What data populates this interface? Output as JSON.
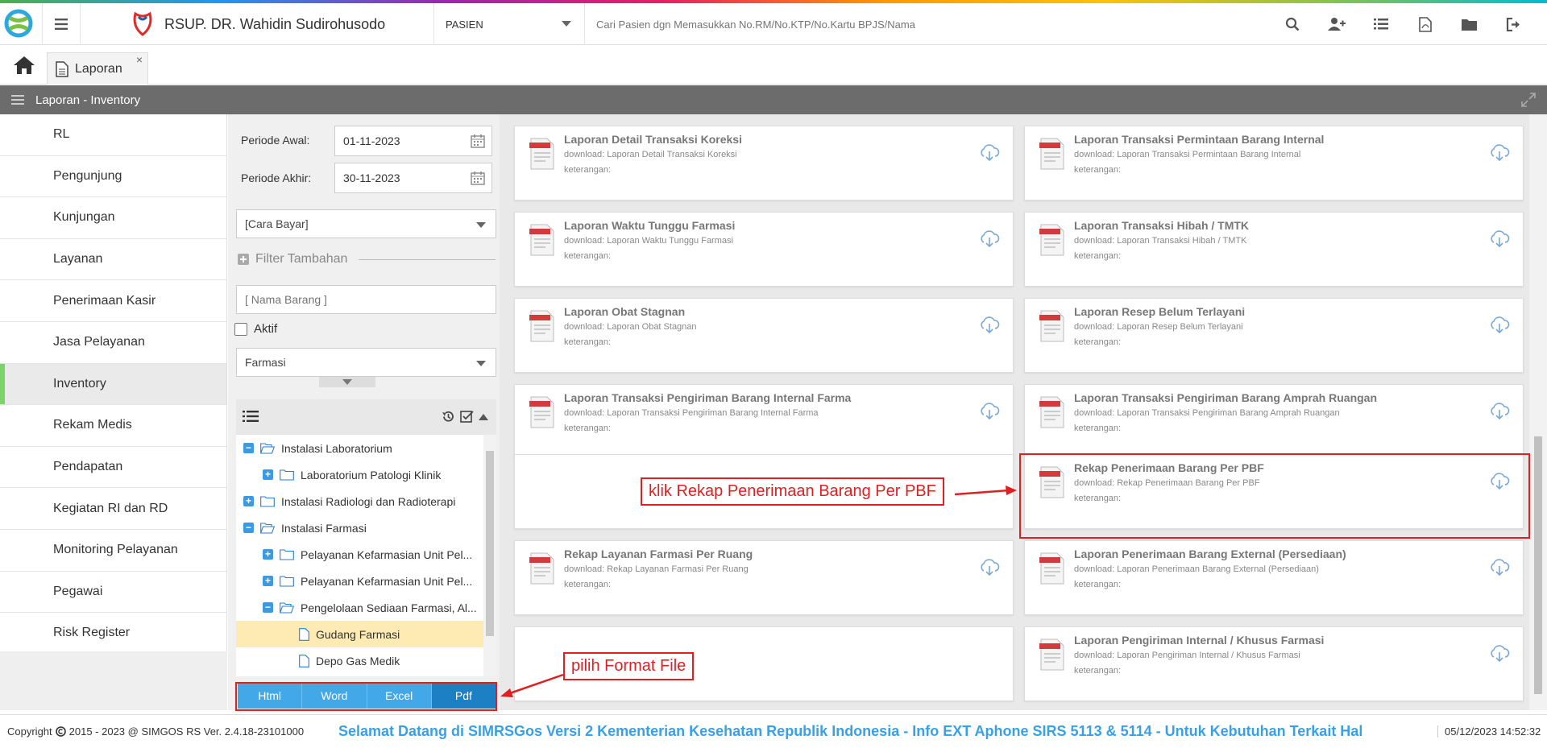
{
  "header": {
    "hospital_name": "RSUP. DR. Wahidin Sudirohusodo",
    "patient_type": "PASIEN",
    "search_placeholder": "Cari Pasien dgn Memasukkan No.RM/No.KTP/No.Kartu BPJS/Nama",
    "icons": [
      "search-icon",
      "add-user-icon",
      "list-icon",
      "pdf-file-icon",
      "folder-icon",
      "logout-icon"
    ]
  },
  "tabs": {
    "active_label": "Laporan",
    "close_glyph": "×"
  },
  "titlebar": {
    "title": "Laporan - Inventory"
  },
  "sidebar": {
    "items": [
      "RL",
      "Pengunjung",
      "Kunjungan",
      "Layanan",
      "Penerimaan Kasir",
      "Jasa Pelayanan",
      "Inventory",
      "Rekam Medis",
      "Pendapatan",
      "Kegiatan RI dan RD",
      "Monitoring Pelayanan",
      "Pegawai",
      "Risk Register"
    ],
    "active": "Inventory"
  },
  "filter": {
    "periode_awal_label": "Periode Awal:",
    "periode_awal_value": "01-11-2023",
    "periode_akhir_label": "Periode Akhir:",
    "periode_akhir_value": "30-11-2023",
    "cara_bayar": "[Cara Bayar]",
    "filter_tambahan": "Filter Tambahan",
    "nama_barang_placeholder": "[ Nama Barang ]",
    "aktif_label": "Aktif",
    "unit": "Farmasi"
  },
  "tree": {
    "items": [
      {
        "label": "Instalasi Laboratorium",
        "toggle": "−",
        "icon": "folder-open"
      },
      {
        "label": "Laboratorium Patologi Klinik",
        "toggle": "+",
        "icon": "folder"
      },
      {
        "label": "Instalasi Radiologi dan Radioterapi",
        "toggle": "+",
        "icon": "folder"
      },
      {
        "label": "Instalasi Farmasi",
        "toggle": "−",
        "icon": "folder-open"
      },
      {
        "label": "Pelayanan Kefarmasian Unit Pel...",
        "toggle": "+",
        "icon": "folder"
      },
      {
        "label": "Pelayanan Kefarmasian Unit Pel...",
        "toggle": "+",
        "icon": "folder"
      },
      {
        "label": "Pengelolaan Sediaan Farmasi, Al...",
        "toggle": "−",
        "icon": "folder-open"
      },
      {
        "label": "Gudang Farmasi",
        "toggle": "",
        "icon": "file"
      },
      {
        "label": "Depo Gas Medik",
        "toggle": "",
        "icon": "file"
      }
    ],
    "selected": "Gudang Farmasi"
  },
  "formats": [
    "Html",
    "Word",
    "Excel",
    "Pdf"
  ],
  "format_selected": "Pdf",
  "reports": {
    "download_prefix": "download: ",
    "keterangan_label": "keterangan:",
    "items": [
      {
        "title": "Laporan Detail Transaksi Koreksi",
        "download": "Laporan Detail Transaksi Koreksi"
      },
      {
        "title": "Laporan Transaksi Permintaan Barang Internal",
        "download": "Laporan Transaksi Permintaan Barang Internal"
      },
      {
        "title": "Laporan Waktu Tunggu Farmasi",
        "download": "Laporan Waktu Tunggu Farmasi"
      },
      {
        "title": "Laporan Transaksi Hibah / TMTK",
        "download": "Laporan Transaksi Hibah / TMTK"
      },
      {
        "title": "Laporan Obat Stagnan",
        "download": "Laporan Obat Stagnan"
      },
      {
        "title": "Laporan Resep Belum Terlayani",
        "download": "Laporan Resep Belum Terlayani"
      },
      {
        "title": "Laporan Transaksi Pengiriman Barang Internal Farma",
        "download": "Laporan Transaksi Pengiriman Barang Internal Farma"
      },
      {
        "title": "Laporan Transaksi Pengiriman Barang Amprah Ruangan",
        "download": "Laporan Transaksi Pengiriman Barang Amprah Ruangan"
      },
      null,
      {
        "title": "Rekap Penerimaan Barang Per PBF",
        "download": "Rekap Penerimaan Barang Per PBF"
      },
      {
        "title": "Rekap Layanan Farmasi Per Ruang",
        "download": "Rekap Layanan Farmasi Per Ruang"
      },
      {
        "title": "Laporan Penerimaan Barang External (Persediaan)",
        "download": "Laporan Penerimaan Barang External (Persediaan)"
      },
      null,
      {
        "title": "Laporan Pengiriman Internal / Khusus Farmasi",
        "download": "Laporan Pengiriman Internal / Khusus Farmasi"
      }
    ]
  },
  "annotations": {
    "rekap_callout": "klik Rekap Penerimaan Barang Per PBF",
    "format_callout": "pilih Format File",
    "color": "#e02020"
  },
  "footer": {
    "copyright": "Copyright",
    "copyright_rest": "2015 - 2023 @ SIMGOS RS Ver. 2.4.18-23101000",
    "marquee": "Selamat Datang di SIMRSGos Versi 2 Kementerian Kesehatan Republik Indonesia - Info EXT Aphone SIRS 5113 & 5114 - Untuk Kebutuhan Terkait Hal",
    "datetime": "05/12/2023 14:52:32"
  },
  "colors": {
    "accent_blue": "#42a8e8",
    "active_green": "#7bd36b",
    "titlebar_gray": "#6c6c6c",
    "selected_tree": "#fdebb3"
  }
}
